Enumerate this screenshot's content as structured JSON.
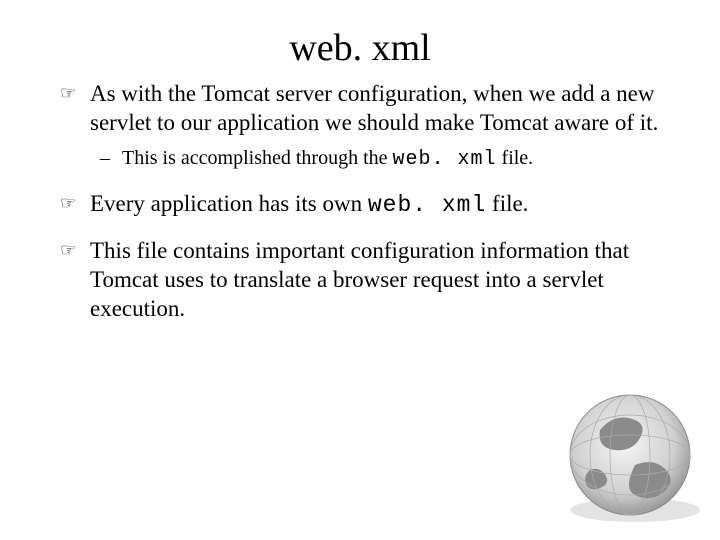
{
  "title": "web. xml",
  "bullets": [
    {
      "text_before": "As with the Tomcat server configuration, when we add a new servlet to our application we should make Tomcat aware of it.",
      "code": "",
      "text_after": "",
      "sub": [
        {
          "text_before": "This is accomplished through the ",
          "code": "web. xml",
          "text_after": " file."
        }
      ]
    },
    {
      "text_before": "Every application has its own ",
      "code": "web. xml",
      "text_after": " file.",
      "sub": []
    },
    {
      "text_before": "This file contains important configuration information that Tomcat uses to translate a browser request into a servlet execution.",
      "code": "",
      "text_after": "",
      "sub": []
    }
  ],
  "decorative": {
    "globe_icon": "globe-icon"
  }
}
